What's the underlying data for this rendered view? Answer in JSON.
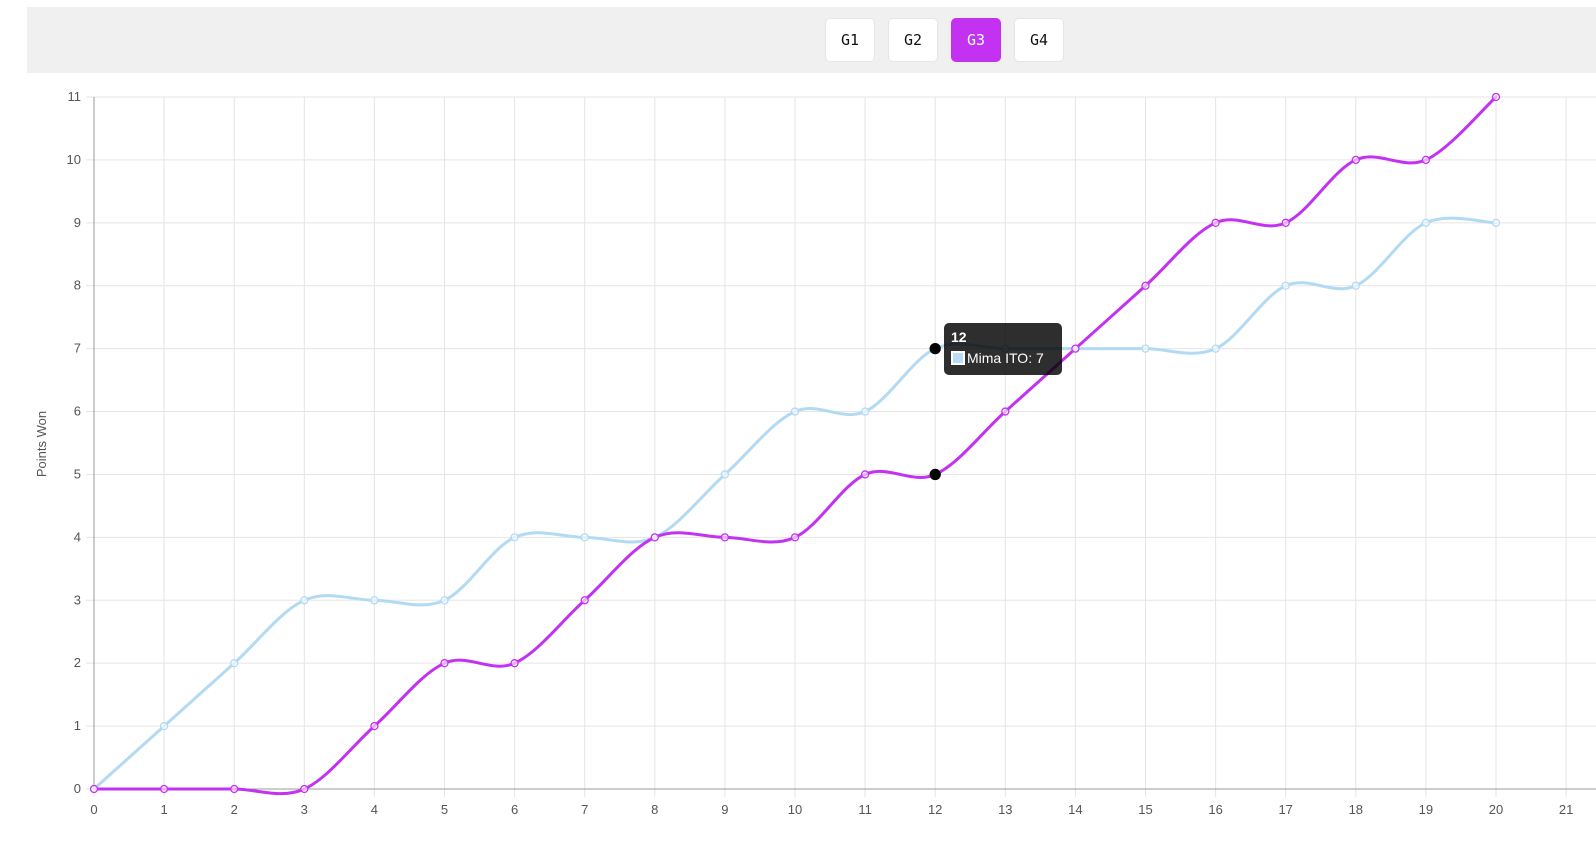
{
  "game_tabs": [
    {
      "label": "G1",
      "active": false
    },
    {
      "label": "G2",
      "active": false
    },
    {
      "label": "G3",
      "active": true
    },
    {
      "label": "G4",
      "active": false
    }
  ],
  "colors": {
    "active_tab": "#c232f0",
    "series_purple": "#c232f0",
    "series_light_blue": "#b3daf3"
  },
  "tooltip": {
    "title": "12",
    "label": "Mima ITO: 7"
  },
  "chart_data": {
    "type": "line",
    "ylabel": "Points Won",
    "xlabel": "",
    "x": [
      0,
      1,
      2,
      3,
      4,
      5,
      6,
      7,
      8,
      9,
      10,
      11,
      12,
      13,
      14,
      15,
      16,
      17,
      18,
      19,
      20
    ],
    "x_ticks": [
      "0",
      "1",
      "2",
      "3",
      "4",
      "5",
      "6",
      "7",
      "8",
      "9",
      "10",
      "11",
      "12",
      "13",
      "14",
      "15",
      "16",
      "17",
      "18",
      "19",
      "20",
      "21"
    ],
    "xlim": [
      0,
      21
    ],
    "ylim": [
      0,
      11
    ],
    "y_ticks": [
      "0",
      "1",
      "2",
      "3",
      "4",
      "5",
      "6",
      "7",
      "8",
      "9",
      "10",
      "11"
    ],
    "grid": true,
    "series": [
      {
        "name": "Mima ITO",
        "color": "#b3daf3",
        "values": [
          0,
          1,
          2,
          3,
          3,
          3,
          4,
          4,
          4,
          5,
          6,
          6,
          7,
          7,
          7,
          7,
          7,
          8,
          8,
          9,
          9
        ]
      },
      {
        "color": "#c232f0",
        "values": [
          0,
          0,
          0,
          0,
          1,
          2,
          2,
          3,
          4,
          4,
          4,
          5,
          5,
          6,
          7,
          8,
          9,
          9,
          10,
          10,
          11
        ]
      }
    ],
    "highlight_index": 12
  }
}
